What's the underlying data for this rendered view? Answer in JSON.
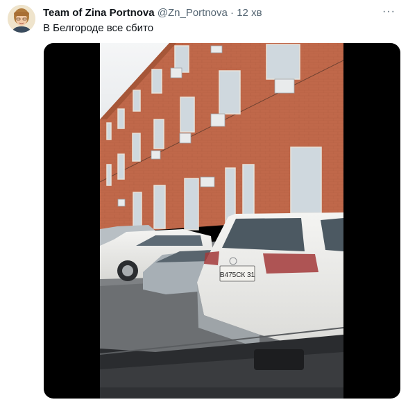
{
  "tweet": {
    "display_name": "Team of Zina Portnova",
    "handle": "@Zn_Portnova",
    "separator": "·",
    "time": "12 хв",
    "text": "В Белгороде все сбито",
    "more_icon": "more-dots-icon"
  },
  "media": {
    "type": "video",
    "plate_text": "В475СК 31"
  },
  "colors": {
    "brick": "#c0684a",
    "background": "#ffffff",
    "text_primary": "#0f1419",
    "text_secondary": "#536471"
  }
}
